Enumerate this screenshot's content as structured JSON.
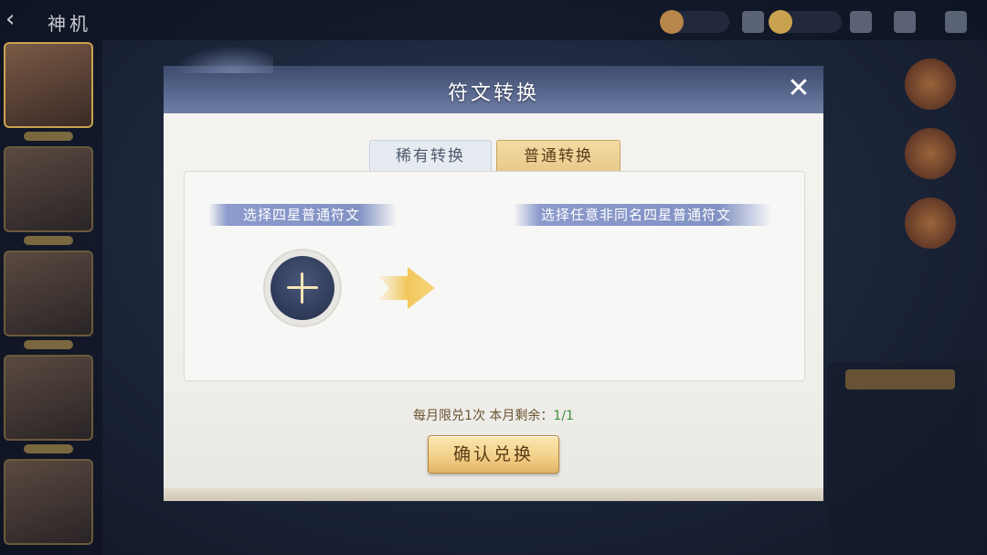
{
  "topbar": {
    "title": "神机",
    "back_icon": "back-arrow-icon"
  },
  "modal": {
    "title": "符文转换",
    "close_icon": "close-icon",
    "tabs": [
      {
        "label": "稀有转换",
        "active": false
      },
      {
        "label": "普通转换",
        "active": true
      }
    ],
    "left_ribbon": "选择四星普通符文",
    "right_ribbon": "选择任意非同名四星普通符文",
    "add_icon": "plus-icon",
    "arrow_icon": "arrow-right-icon",
    "limit": {
      "text": "每月限兑1次 本月剩余：",
      "count": "1/1"
    },
    "confirm_label": "确认兑换"
  },
  "colors": {
    "header": "#55648a",
    "tab_active": "#f3dca4",
    "ribbon": "#8292c4",
    "button": "#f3d089",
    "count_green": "#3f8f3a"
  }
}
